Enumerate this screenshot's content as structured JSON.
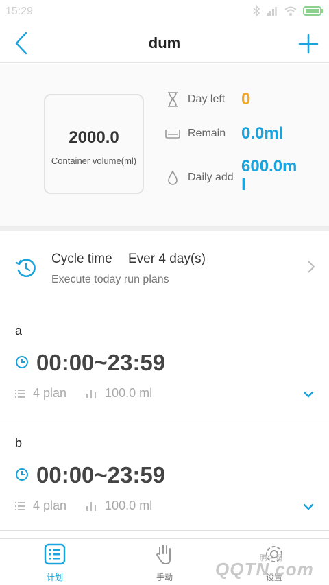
{
  "status": {
    "time": "15:29"
  },
  "header": {
    "title": "dum"
  },
  "summary": {
    "volume_value": "2000.0",
    "volume_label": "Container volume(ml)",
    "day_left_label": "Day left",
    "day_left_value": "0",
    "remain_label": "Remain",
    "remain_value": "0.0ml",
    "daily_add_label": "Daily add",
    "daily_add_value_line1": "600.0m",
    "daily_add_value_line2": "l"
  },
  "cycle": {
    "title": "Cycle time",
    "value": "Ever 4 day(s)",
    "subtitle": "Execute today run plans"
  },
  "plans": [
    {
      "name": "a",
      "time_range": "00:00~23:59",
      "plan_count": "4 plan",
      "volume": "100.0 ml"
    },
    {
      "name": "b",
      "time_range": "00:00~23:59",
      "plan_count": "4 plan",
      "volume": "100.0 ml"
    }
  ],
  "tabs": [
    {
      "label": "计划",
      "active": true
    },
    {
      "label": "手动",
      "active": false
    },
    {
      "label": "设置",
      "active": false
    }
  ],
  "watermark": {
    "text": "腾牛网",
    "logo": "QQTN.com"
  },
  "colors": {
    "accent": "#1aa3dd",
    "orange": "#f5a623",
    "muted": "#aaaaaa"
  }
}
